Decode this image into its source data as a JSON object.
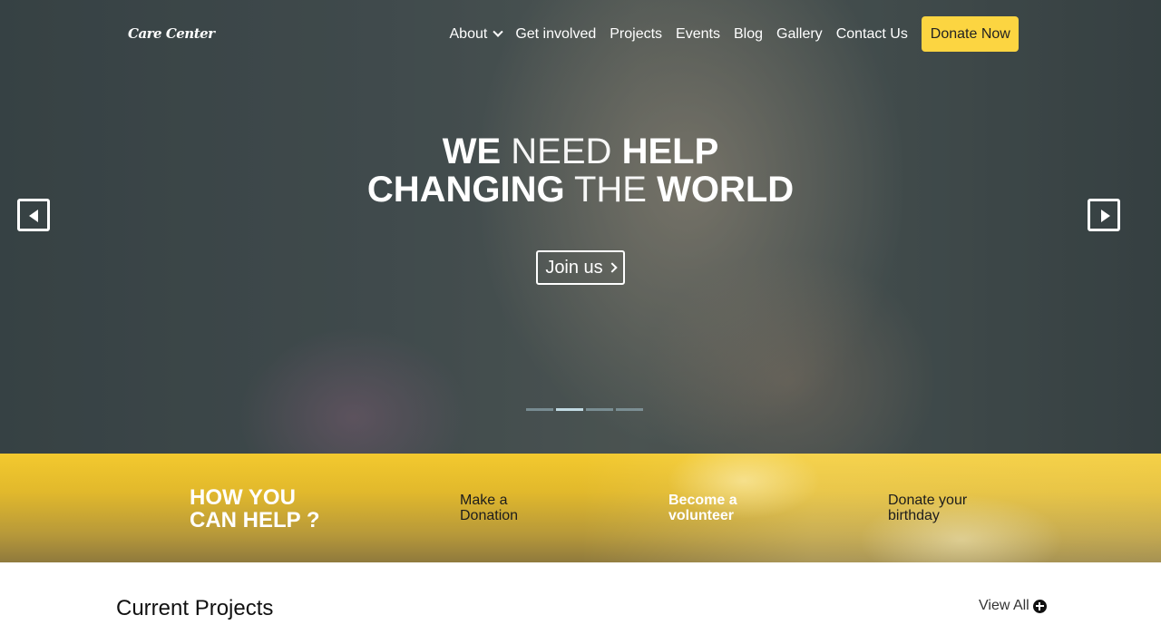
{
  "header": {
    "logo": "Care Center",
    "nav": {
      "about": "About",
      "get_involved": "Get involved",
      "projects": "Projects",
      "events": "Events",
      "blog": "Blog",
      "gallery": "Gallery",
      "contact": "Contact Us"
    },
    "donate_label": "Donate Now"
  },
  "hero": {
    "line1": {
      "w1": "WE",
      "w2": "NEED",
      "w3": "HELP"
    },
    "line2": {
      "w1": "CHANGING",
      "w2": "THE",
      "w3": "WORLD"
    },
    "join_label": "Join us",
    "active_slide": 2,
    "slide_count": 4
  },
  "help": {
    "title_line1": "HOW YOU",
    "title_line2": "CAN HELP ?",
    "items": [
      {
        "line1": "Make a",
        "line2": "Donation"
      },
      {
        "line1": "Become a",
        "line2": "volunteer"
      },
      {
        "line1": "Donate your",
        "line2": "birthday"
      }
    ]
  },
  "projects": {
    "title": "Current Projects",
    "view_all": "View All"
  },
  "colors": {
    "accent": "#fcd541",
    "band_top": "#f3c92e",
    "text_dark": "#111111"
  },
  "icons": [
    "chevron-down-icon",
    "chevron-right-icon",
    "caret-left-icon",
    "caret-right-icon",
    "plus-circle-icon"
  ]
}
